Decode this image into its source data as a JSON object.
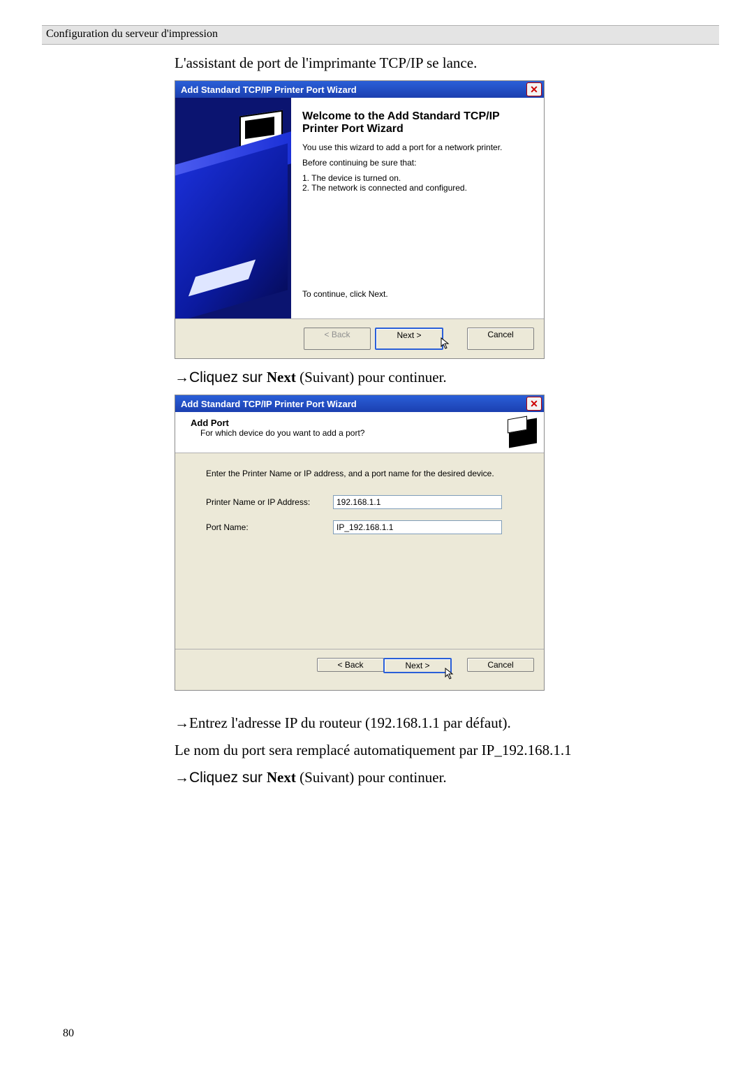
{
  "page_number": "80",
  "header_text": "Configuration du serveur d'impression",
  "intro_line": "L'assistant de port de l'imprimante TCP/IP se lance.",
  "click_next_line_prefix": "→Cliquez sur ",
  "click_next_line_bold": "Next",
  "click_next_line_suffix": " (Suivant) pour continuer.",
  "enter_ip_line": "→Entrez l'adresse IP du routeur (192.168.1.1 par défaut).",
  "port_auto_line": "Le nom du port sera remplacé automatiquement par IP_192.168.1.1",
  "wizard1": {
    "title": "Add Standard TCP/IP Printer Port Wizard",
    "heading": "Welcome to the Add Standard TCP/IP Printer Port Wizard",
    "p1": "You use this wizard to add a port for a network printer.",
    "p2": "Before continuing be sure that:",
    "li1": "1.  The device is turned on.",
    "li2": "2.  The network is connected and configured.",
    "continue_hint": "To continue, click Next.",
    "back_label": "< Back",
    "next_label": "Next >",
    "cancel_label": "Cancel"
  },
  "wizard2": {
    "title": "Add Standard TCP/IP Printer Port Wizard",
    "subtitle": "Add Port",
    "subquestion": "For which device do you want to add a port?",
    "instruction": "Enter the Printer Name or IP address, and a port name for the desired device.",
    "label_ip": "Printer Name or IP Address:",
    "label_port": "Port Name:",
    "value_ip": "192.168.1.1",
    "value_port": "IP_192.168.1.1",
    "back_label": "< Back",
    "next_label": "Next >",
    "cancel_label": "Cancel"
  }
}
